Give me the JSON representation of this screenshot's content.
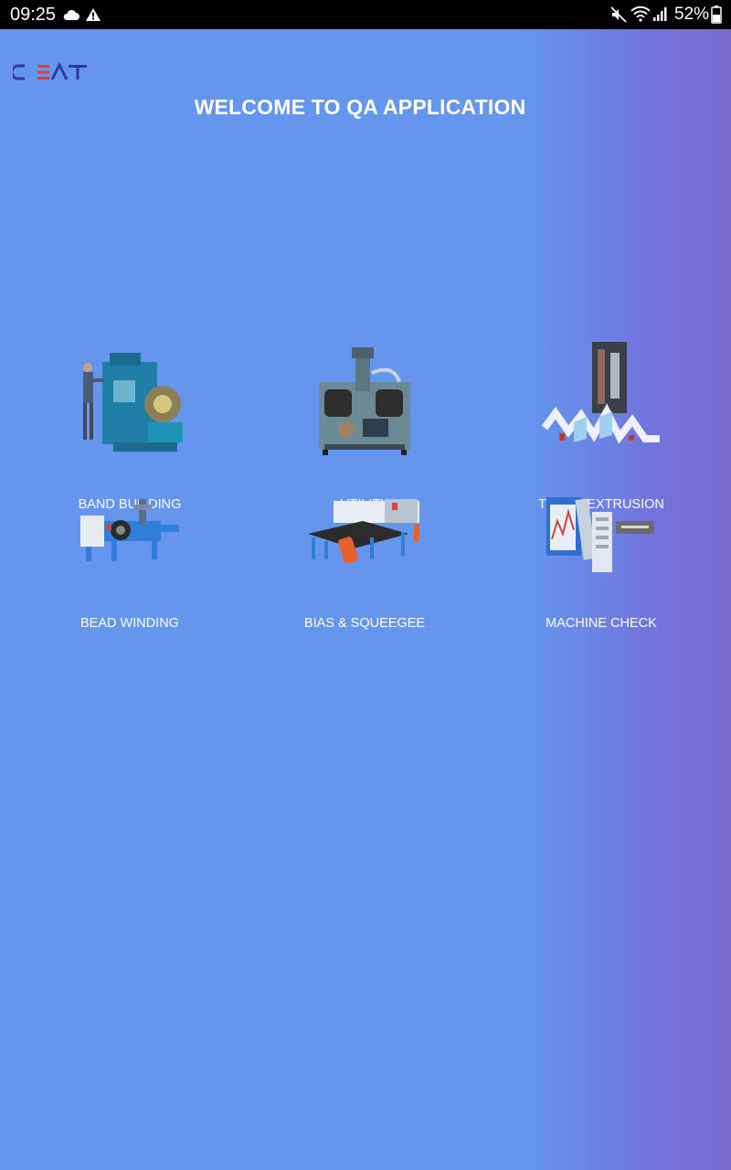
{
  "status_bar": {
    "time": "09:25",
    "icons_left": [
      "cloud-icon",
      "alert-icon"
    ],
    "icons_right": [
      "mute-icon",
      "wifi-icon",
      "signal-icon"
    ],
    "battery": "52%"
  },
  "app": {
    "logo_text": "CEAT",
    "title": "WELCOME TO QA APPLICATION"
  },
  "menu": {
    "items": [
      {
        "label": "BAND BUILDING",
        "icon": "band-building-machine-icon"
      },
      {
        "label": "UTILITY",
        "icon": "utility-machine-icon"
      },
      {
        "label": "TREAD EXTRUSION",
        "icon": "tread-extrusion-icon"
      },
      {
        "label": "BEAD WINDING",
        "icon": "bead-winding-machine-icon"
      },
      {
        "label": "BIAS & SQUEEGEE",
        "icon": "bias-squeegee-machine-icon"
      },
      {
        "label": "MACHINE CHECK",
        "icon": "machine-check-icon"
      }
    ]
  },
  "colors": {
    "background_start": "#6496ee",
    "background_end": "#7b6bcf",
    "status_bar": "#000000",
    "text": "#ffffff",
    "logo_blue": "#2b3a9e",
    "logo_red": "#e23b3b"
  }
}
